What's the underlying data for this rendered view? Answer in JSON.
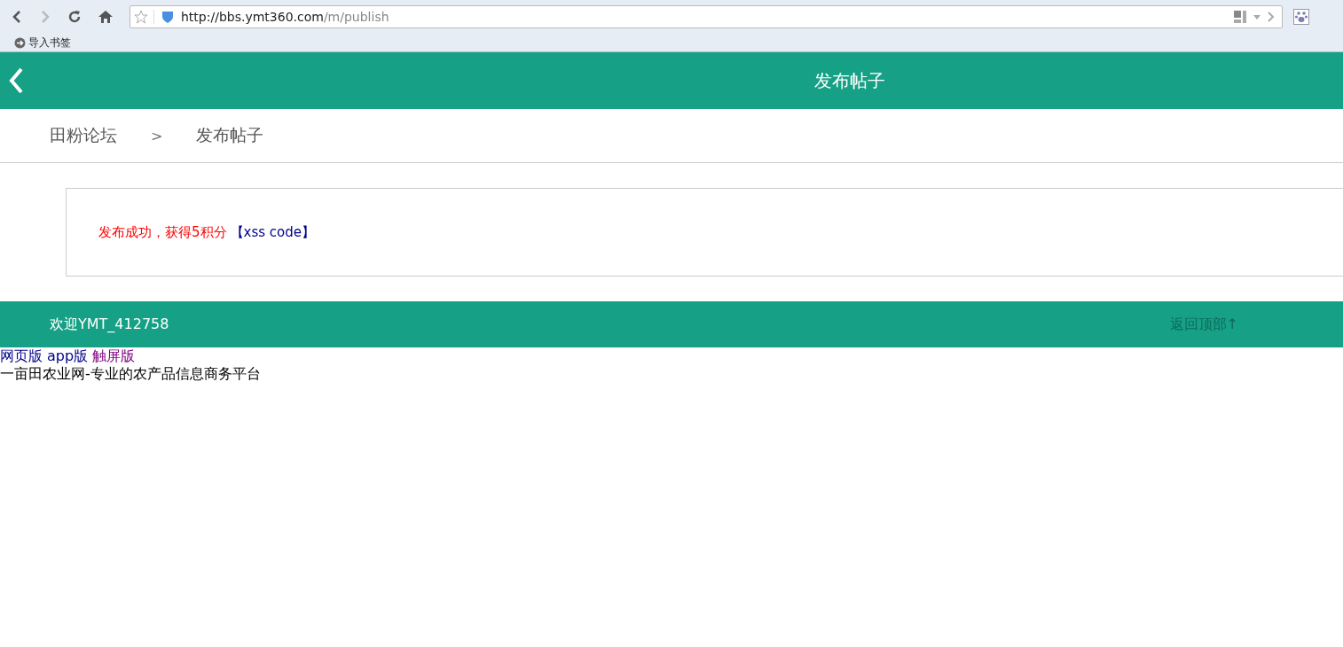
{
  "browser": {
    "url_host": "http://bbs.ymt360.com",
    "url_path": "/m/publish",
    "forward_disabled": true,
    "bookmark": "导入书签"
  },
  "header": {
    "title": "发布帖子"
  },
  "breadcrumb": [
    {
      "label": "田粉论坛"
    },
    {
      "label": ">"
    },
    {
      "label": "发布帖子"
    }
  ],
  "message": {
    "text": "发布成功，获得5积分",
    "link": "【xss code】"
  },
  "footer": {
    "welcome": "欢迎YMT_412758",
    "back_to_top": "返回顶部↑"
  },
  "versions": [
    {
      "label": "网页版",
      "color": "#00008b"
    },
    {
      "label": "app版",
      "color": "#00008b"
    },
    {
      "label": "触屏版",
      "color": "#800080"
    }
  ],
  "tagline": "一亩田农业网-专业的农产品信息商务平台"
}
